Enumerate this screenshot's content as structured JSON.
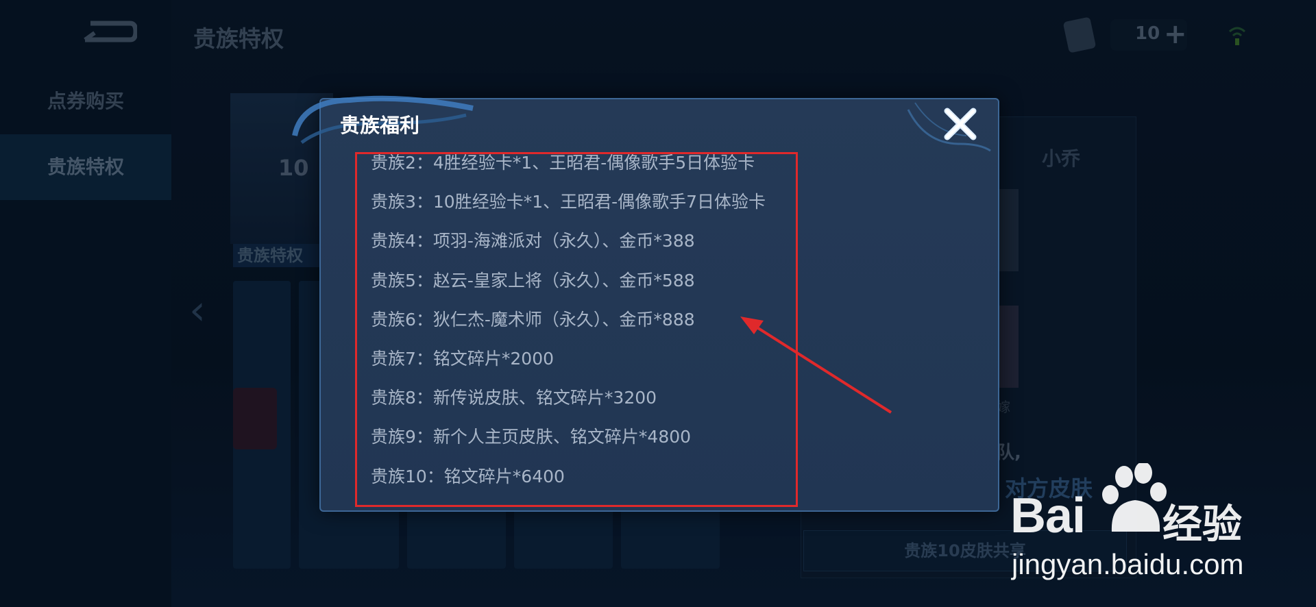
{
  "header": {
    "title": "贵族特权",
    "coin_count": "10"
  },
  "sidebar": {
    "items": [
      {
        "label": "点券购买"
      },
      {
        "label": "贵族特权"
      }
    ]
  },
  "background": {
    "emblem_text": "10",
    "section_label": "贵族特权",
    "right_name": "小乔",
    "right_fragment_1": "嫁",
    "right_fragment_2": "队,",
    "right_banner": "对方皮肤",
    "share_button": "贵族10皮肤共享"
  },
  "modal": {
    "title": "贵族福利",
    "items": [
      "贵族2：4胜经验卡*1、王昭君-偶像歌手5日体验卡",
      "贵族3：10胜经验卡*1、王昭君-偶像歌手7日体验卡",
      "贵族4：项羽-海滩派对（永久）、金币*388",
      "贵族5：赵云-皇家上将（永久）、金币*588",
      "贵族6：狄仁杰-魔术师（永久）、金币*888",
      "贵族7：铭文碎片*2000",
      "贵族8：新传说皮肤、铭文碎片*3200",
      "贵族9：新个人主页皮肤、铭文碎片*4800",
      "贵族10：铭文碎片*6400"
    ]
  },
  "watermark": {
    "brand": "Bai",
    "cn": "经验",
    "url": "jingyan.baidu.com"
  },
  "colors": {
    "annotation": "#e0292b",
    "modal_bg": "#253a57",
    "modal_border": "#3d6796"
  }
}
